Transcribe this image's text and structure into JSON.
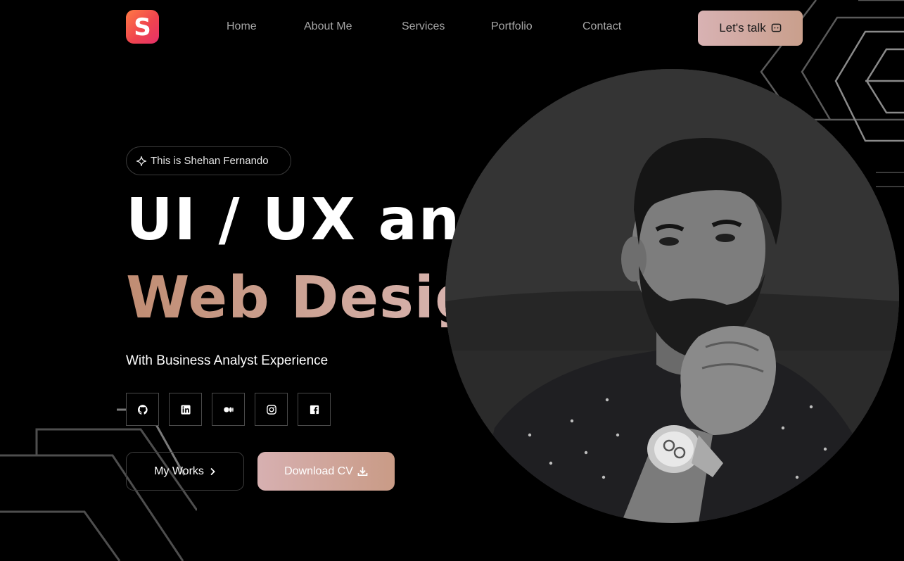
{
  "header": {
    "logo_letter": "S",
    "nav": [
      {
        "label": "Home"
      },
      {
        "label": "About Me"
      },
      {
        "label": "Services"
      },
      {
        "label": "Portfolio"
      },
      {
        "label": "Contact"
      }
    ],
    "cta_label": "Let's talk",
    "cta_icon": "chat-icon"
  },
  "hero": {
    "badge": "This is Shehan Fernando",
    "badge_icon": "sparkle-icon",
    "title_line1": "UI / UX and",
    "title_line2": "Web Designer.",
    "tagline": "With Business Analyst Experience",
    "socials": [
      {
        "icon": "github-icon"
      },
      {
        "icon": "linkedin-icon"
      },
      {
        "icon": "medium-icon"
      },
      {
        "icon": "instagram-icon"
      },
      {
        "icon": "facebook-icon"
      }
    ],
    "works_label": "My Works",
    "cv_label": "Download CV"
  },
  "colors": {
    "background": "#000000",
    "accent_start": "#c08c72",
    "accent_end": "#e2c2c6",
    "nav_text": "#a6a6a6",
    "logo_start": "#ff7a45",
    "logo_end": "#e6306a"
  }
}
